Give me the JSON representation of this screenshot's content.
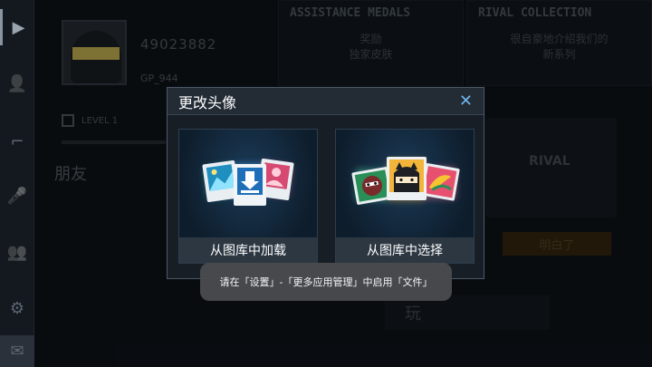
{
  "sidebar": {
    "items": [
      {
        "icon": "play-icon",
        "glyph": "▶"
      },
      {
        "icon": "user-icon",
        "glyph": "👤"
      },
      {
        "icon": "gun-icon",
        "glyph": "⌐"
      },
      {
        "icon": "microphone-icon",
        "glyph": "🎤"
      },
      {
        "icon": "friends-icon",
        "glyph": "👥"
      },
      {
        "icon": "gear-icon",
        "glyph": "⚙"
      },
      {
        "icon": "mail-icon",
        "glyph": "✉"
      }
    ]
  },
  "profile": {
    "id": "49023882",
    "name": "GP_944",
    "level_label": "LEVEL 1"
  },
  "friends": {
    "title": "朋友"
  },
  "assistance_panel": {
    "title": "ASSISTANCE MEDALS",
    "line1": "奖励",
    "line2": "独家皮肤"
  },
  "rival_panel": {
    "title": "RIVAL COLLECTION",
    "line1": "很自豪地介绍我们的",
    "line2": "新系列",
    "art_word": "RIVAL",
    "button": "明白了"
  },
  "play_button": "玩",
  "modal": {
    "title": "更改头像",
    "close_glyph": "✕",
    "load_label": "从图库中加载",
    "choose_label": "从图库中选择"
  },
  "toast": {
    "text": "请在「设置」-「更多应用管理」中启用「文件」"
  },
  "colors": {
    "accent": "#6fb6ee",
    "modal_bg": "#181e25",
    "toast_bg": "#4a4b4f"
  }
}
